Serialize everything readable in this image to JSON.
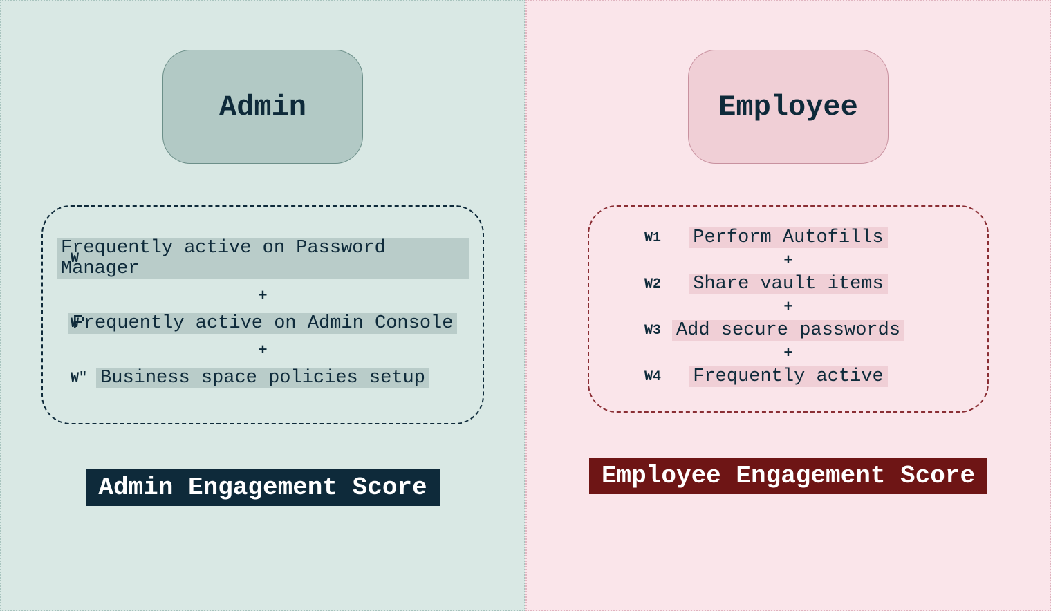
{
  "admin": {
    "title": "Admin",
    "weights": [
      "W",
      "W'",
      "W\""
    ],
    "items": [
      "Frequently active on Password Manager",
      "Frequently active on Admin Console",
      "Business space policies setup"
    ],
    "score_label": "Admin Engagement Score"
  },
  "employee": {
    "title": "Employee",
    "weights": [
      "W1",
      "W2",
      "W3",
      "W4"
    ],
    "items": [
      "Perform Autofills",
      "Share vault items",
      "Add secure passwords",
      "Frequently active"
    ],
    "score_label": "Employee Engagement Score"
  },
  "plus": "+"
}
